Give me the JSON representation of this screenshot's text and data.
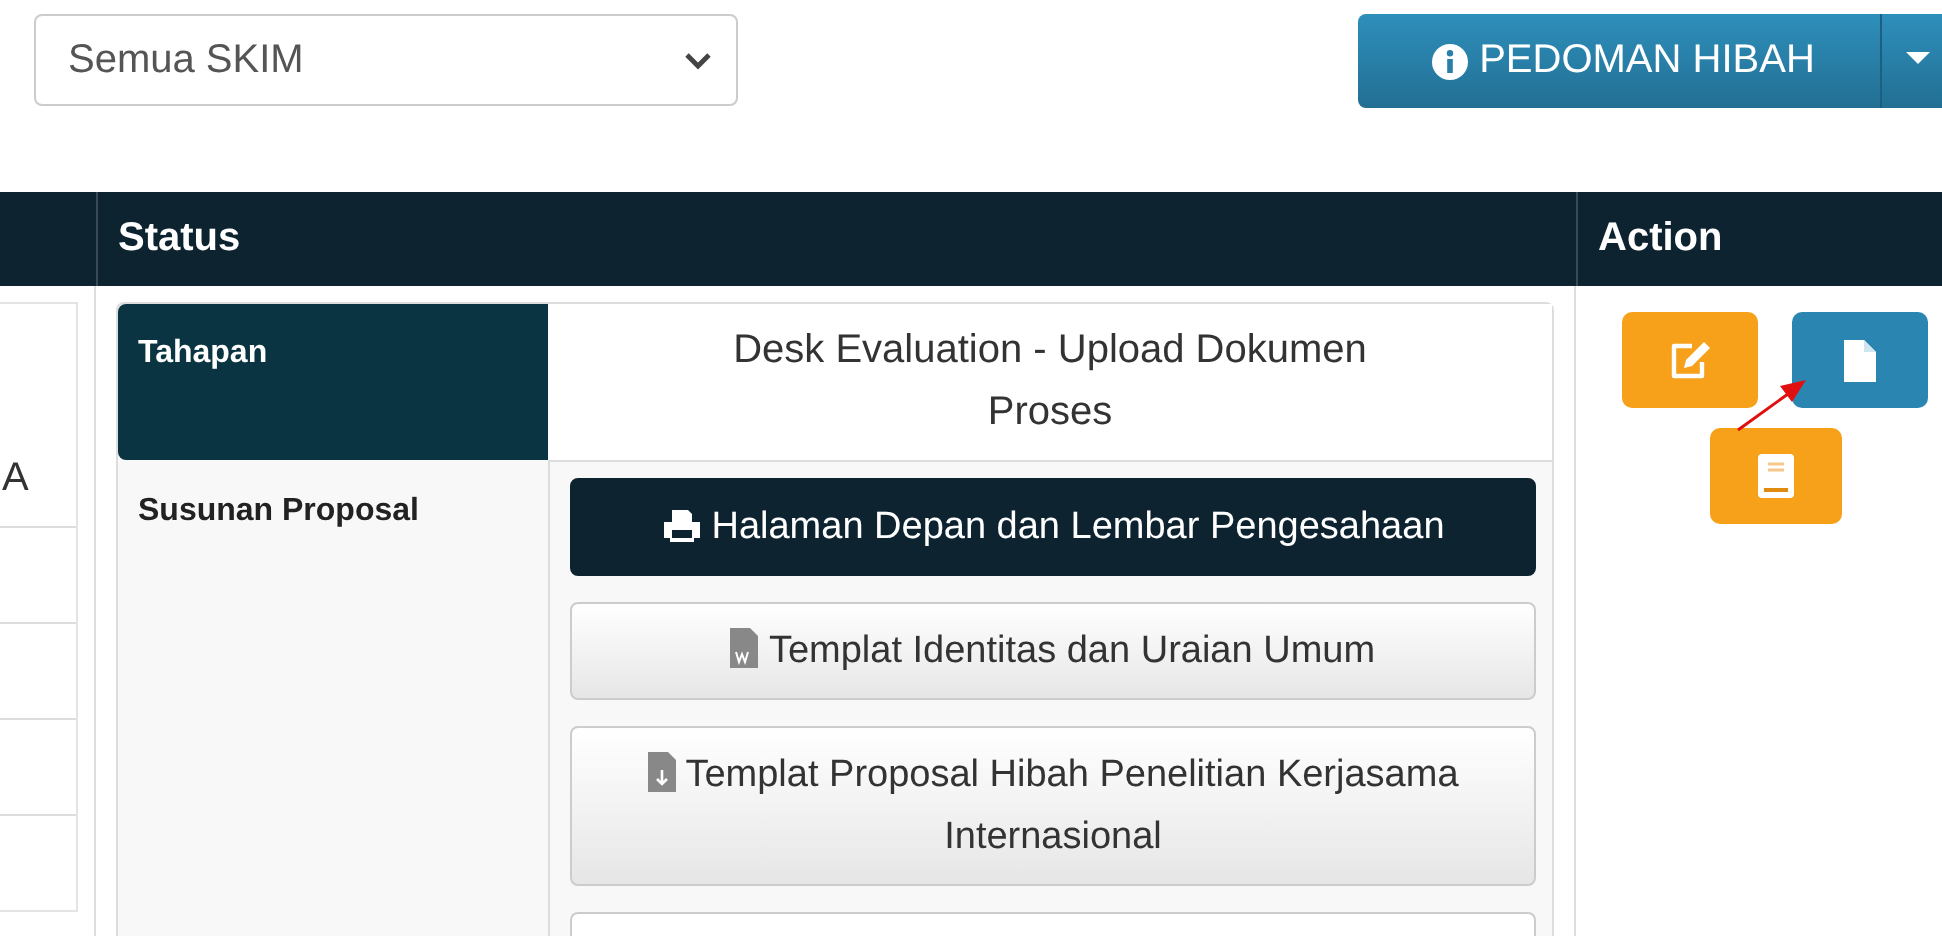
{
  "filter_select": {
    "value": "Semua SKIM"
  },
  "guide_button": {
    "label": "PEDOMAN HIBAH"
  },
  "table": {
    "columns": [
      {
        "label": "Status"
      },
      {
        "label": "Action"
      }
    ],
    "column_1_cells": [
      "A",
      "",
      "",
      "",
      ""
    ],
    "status_rows": [
      {
        "label": "Tahapan",
        "selected": true,
        "kind": "text",
        "value": "Desk Evaluation - Upload Dokumen Proses"
      },
      {
        "label": "Susunan Proposal",
        "selected": false,
        "kind": "buttons",
        "buttons": [
          {
            "kind": "print",
            "primary": true,
            "label": "Halaman Depan dan Lembar Pengesahaan"
          },
          {
            "kind": "word",
            "primary": false,
            "label": "Templat Identitas dan Uraian Umum"
          },
          {
            "kind": "download",
            "primary": false,
            "label": "Templat Proposal Hibah Penelitian Kerjasama Internasional"
          }
        ]
      }
    ],
    "actions": [
      {
        "kind": "edit",
        "color": "#f7a11a"
      },
      {
        "kind": "file",
        "color": "#2a86b0"
      },
      {
        "kind": "book",
        "color": "#f7a11a"
      }
    ]
  }
}
